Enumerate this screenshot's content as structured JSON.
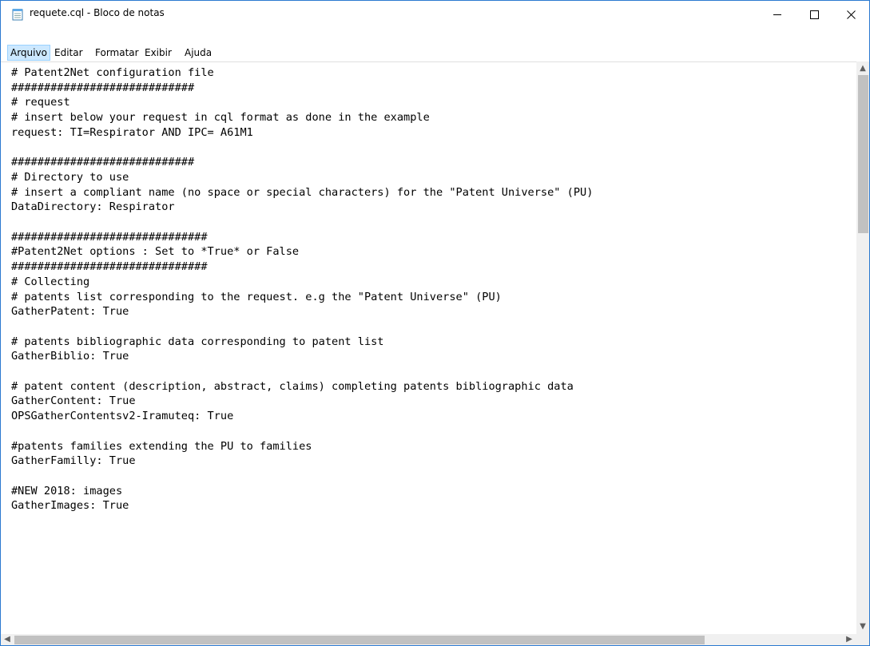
{
  "window": {
    "title": "requete.cql - Bloco de notas"
  },
  "menu": {
    "items": [
      "Arquivo",
      "Editar",
      "Formatar",
      "Exibir",
      "Ajuda"
    ]
  },
  "editor": {
    "content": "# Patent2Net configuration file\n############################\n# request\n# insert below your request in cql format as done in the example\nrequest: TI=Respirator AND IPC= A61M1\n\n############################\n# Directory to use\n# insert a compliant name (no space or special characters) for the \"Patent Universe\" (PU)\nDataDirectory: Respirator\n\n##############################\n#Patent2Net options : Set to *True* or False\n##############################\n# Collecting\n# patents list corresponding to the request. e.g the \"Patent Universe\" (PU)\nGatherPatent: True\n\n# patents bibliographic data corresponding to patent list\nGatherBiblio: True\n\n# patent content (description, abstract, claims) completing patents bibliographic data\nGatherContent: True\nOPSGatherContentsv2-Iramuteq: True\n\n#patents families extending the PU to families\nGatherFamilly: True\n\n#NEW 2018: images\nGatherImages: True"
  }
}
